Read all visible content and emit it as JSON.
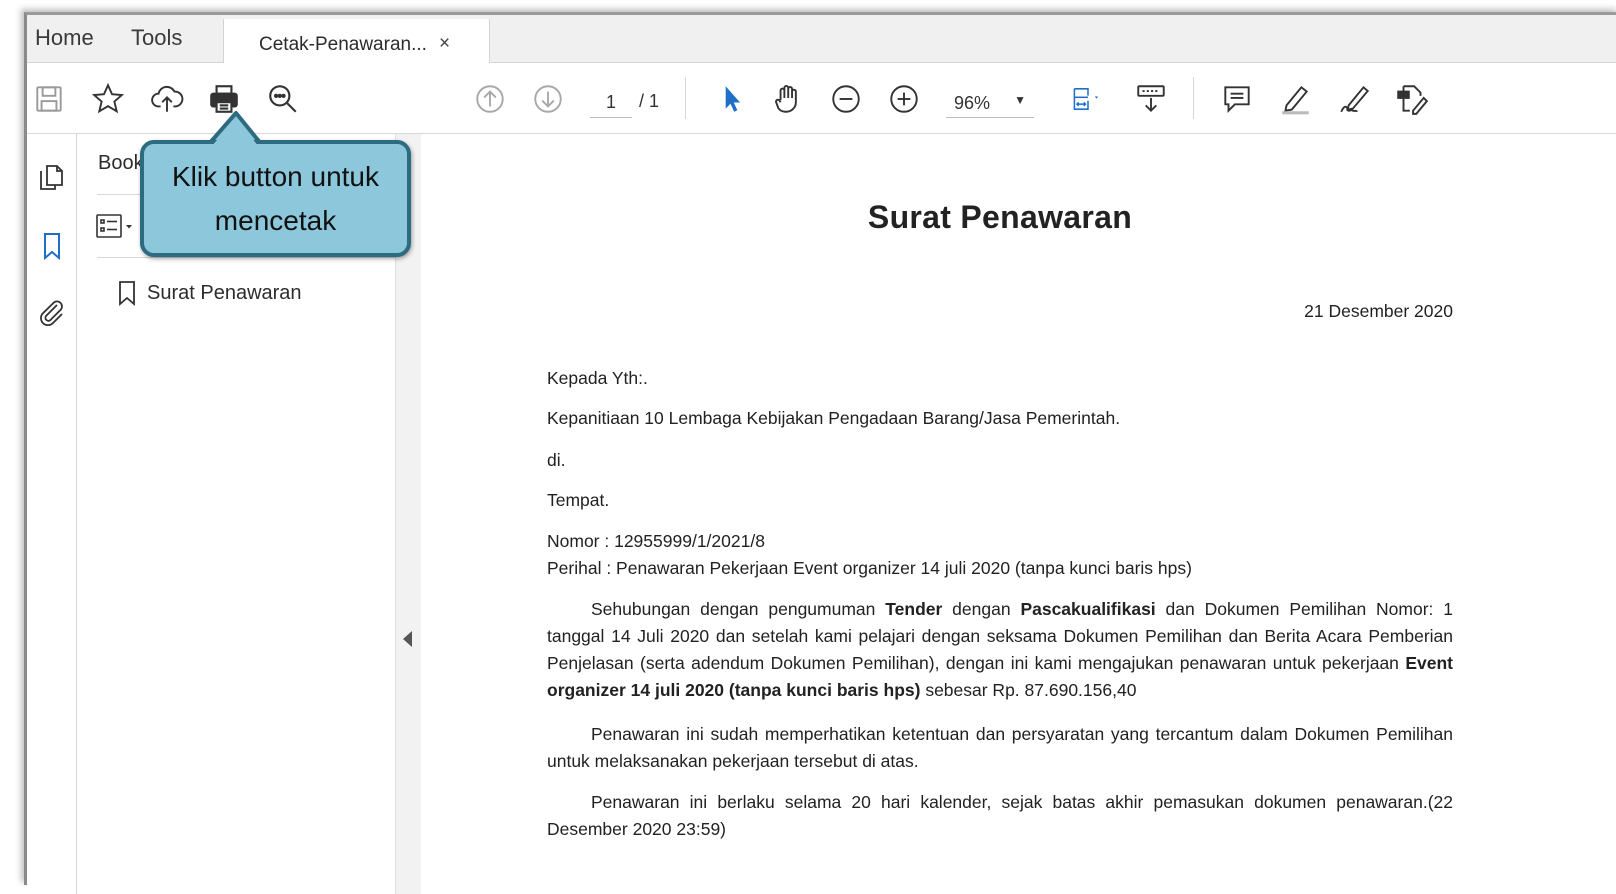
{
  "tabs": {
    "home": "Home",
    "tools": "Tools",
    "document": "Cetak-Penawaran...",
    "close": "×"
  },
  "toolbar": {
    "page_current": "1",
    "page_total": "/ 1",
    "zoom": "96%",
    "icons": [
      "save-icon",
      "star-icon",
      "cloud-upload-icon",
      "print-icon",
      "search-zoom-icon",
      "prev-page-icon",
      "next-page-icon",
      "select-cursor-icon",
      "hand-icon",
      "zoom-out-icon",
      "zoom-in-icon",
      "fit-page-icon",
      "scroll-mode-icon",
      "comment-icon",
      "highlight-icon",
      "sign-icon",
      "edit-icon"
    ]
  },
  "sidebar": {
    "title": "Bookmarks",
    "bookmarks": [
      {
        "label": "Surat Penawaran"
      }
    ]
  },
  "callout": {
    "line1": "Klik button untuk",
    "line2": "mencetak"
  },
  "document": {
    "title": "Surat Penawaran",
    "date": "21 Desember 2020",
    "recipient": "Kepada Yth:.",
    "org": "Kepanitiaan 10 Lembaga Kebijakan Pengadaan Barang/Jasa Pemerintah.",
    "di": "di.",
    "tempat": "Tempat.",
    "nomor": "Nomor : 12955999/1/2021/8",
    "perihal": "Perihal : Penawaran Pekerjaan Event organizer 14 juli 2020 (tanpa kunci baris hps)",
    "para1": {
      "t1": "Sehubungan dengan pengumuman ",
      "b1": "Tender",
      "t2": " dengan ",
      "b2": "Pascakualifikasi",
      "t3": " dan Dokumen Pemilihan Nomor: 1 tanggal 14 Juli 2020 dan setelah kami pelajari dengan seksama Dokumen Pemilihan dan Berita Acara Pemberian Penjelasan (serta adendum Dokumen Pemilihan), dengan ini kami mengajukan penawaran untuk pekerjaan ",
      "b3": "Event organizer 14 juli 2020 (tanpa kunci baris hps)",
      "t4": " sebesar Rp. 87.690.156,40"
    },
    "para2": "Penawaran ini sudah memperhatikan ketentuan dan persyaratan yang tercantum dalam Dokumen Pemilihan untuk melaksanakan pekerjaan tersebut di atas.",
    "para3": "Penawaran ini berlaku selama 20 hari kalender, sejak batas akhir pemasukan dokumen penawaran.(22 Desember 2020 23:59)"
  }
}
